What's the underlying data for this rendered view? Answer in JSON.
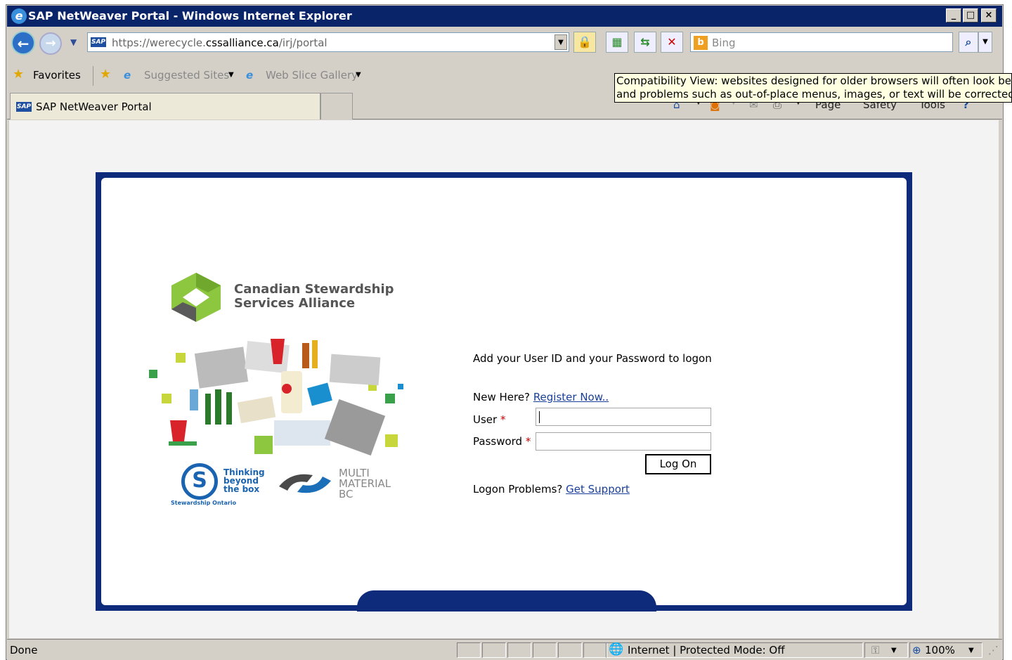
{
  "window": {
    "title": "SAP NetWeaver Portal - Windows Internet Explorer"
  },
  "nav": {
    "url_prefix": "https://",
    "url_host": "werecycle.",
    "url_domain": "cssalliance.ca",
    "url_path": "/irj/portal",
    "search_placeholder": "Bing"
  },
  "favorites": {
    "label": "Favorites",
    "suggested": "Suggested Sites",
    "webslice": "Web Slice Gallery"
  },
  "tab": {
    "label": "SAP NetWeaver Portal"
  },
  "commands": {
    "page": "Page",
    "safety": "Safety",
    "tools": "Tools"
  },
  "tooltip": {
    "line1": "Compatibility View: websites designed for older browsers will often look better,",
    "line2": "and problems such as out-of-place menus, images, or text will be corrected."
  },
  "branding": {
    "org_line1": "Canadian Stewardship",
    "org_line2": "Services Alliance",
    "stew_tagline": "Thinking beyond the box",
    "stew_name": "Stewardship Ontario",
    "mm_text": "MULTI MATERIAL BC"
  },
  "login": {
    "instruction": "Add your User ID and your Password to logon",
    "new_here": "New Here?",
    "register": "Register Now..",
    "user_label": "User",
    "password_label": "Password",
    "required_mark": "*",
    "logon_button": "Log On",
    "problems": "Logon Problems?",
    "support": "Get Support"
  },
  "status": {
    "text": "Done",
    "zone": "Internet | Protected Mode: Off",
    "zoom": "100%"
  },
  "colors": {
    "title_bar": "#0a246a",
    "panel": "#0e2a7a",
    "link": "#1a3f9a",
    "logo_green": "#8dc63f"
  }
}
